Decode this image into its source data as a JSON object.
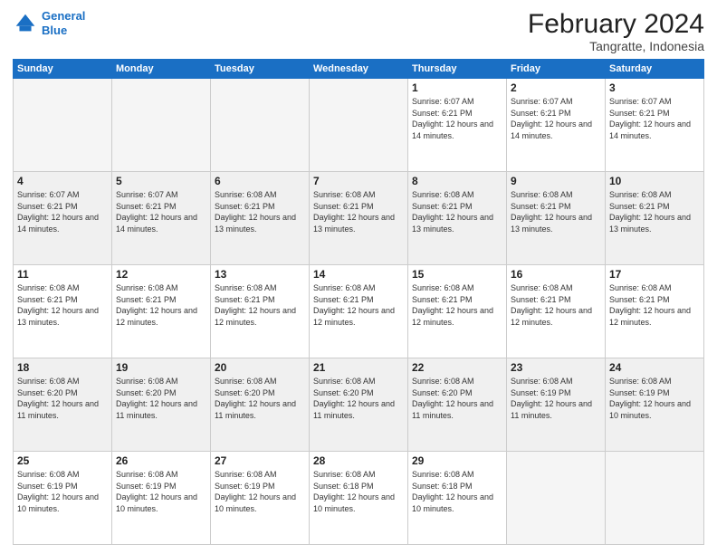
{
  "logo": {
    "line1": "General",
    "line2": "Blue"
  },
  "title": "February 2024",
  "location": "Tangratte, Indonesia",
  "days_header": [
    "Sunday",
    "Monday",
    "Tuesday",
    "Wednesday",
    "Thursday",
    "Friday",
    "Saturday"
  ],
  "weeks": [
    [
      {
        "day": "",
        "sunrise": "",
        "sunset": "",
        "daylight": ""
      },
      {
        "day": "",
        "sunrise": "",
        "sunset": "",
        "daylight": ""
      },
      {
        "day": "",
        "sunrise": "",
        "sunset": "",
        "daylight": ""
      },
      {
        "day": "",
        "sunrise": "",
        "sunset": "",
        "daylight": ""
      },
      {
        "day": "1",
        "sunrise": "Sunrise: 6:07 AM",
        "sunset": "Sunset: 6:21 PM",
        "daylight": "Daylight: 12 hours and 14 minutes."
      },
      {
        "day": "2",
        "sunrise": "Sunrise: 6:07 AM",
        "sunset": "Sunset: 6:21 PM",
        "daylight": "Daylight: 12 hours and 14 minutes."
      },
      {
        "day": "3",
        "sunrise": "Sunrise: 6:07 AM",
        "sunset": "Sunset: 6:21 PM",
        "daylight": "Daylight: 12 hours and 14 minutes."
      }
    ],
    [
      {
        "day": "4",
        "sunrise": "Sunrise: 6:07 AM",
        "sunset": "Sunset: 6:21 PM",
        "daylight": "Daylight: 12 hours and 14 minutes."
      },
      {
        "day": "5",
        "sunrise": "Sunrise: 6:07 AM",
        "sunset": "Sunset: 6:21 PM",
        "daylight": "Daylight: 12 hours and 14 minutes."
      },
      {
        "day": "6",
        "sunrise": "Sunrise: 6:08 AM",
        "sunset": "Sunset: 6:21 PM",
        "daylight": "Daylight: 12 hours and 13 minutes."
      },
      {
        "day": "7",
        "sunrise": "Sunrise: 6:08 AM",
        "sunset": "Sunset: 6:21 PM",
        "daylight": "Daylight: 12 hours and 13 minutes."
      },
      {
        "day": "8",
        "sunrise": "Sunrise: 6:08 AM",
        "sunset": "Sunset: 6:21 PM",
        "daylight": "Daylight: 12 hours and 13 minutes."
      },
      {
        "day": "9",
        "sunrise": "Sunrise: 6:08 AM",
        "sunset": "Sunset: 6:21 PM",
        "daylight": "Daylight: 12 hours and 13 minutes."
      },
      {
        "day": "10",
        "sunrise": "Sunrise: 6:08 AM",
        "sunset": "Sunset: 6:21 PM",
        "daylight": "Daylight: 12 hours and 13 minutes."
      }
    ],
    [
      {
        "day": "11",
        "sunrise": "Sunrise: 6:08 AM",
        "sunset": "Sunset: 6:21 PM",
        "daylight": "Daylight: 12 hours and 13 minutes."
      },
      {
        "day": "12",
        "sunrise": "Sunrise: 6:08 AM",
        "sunset": "Sunset: 6:21 PM",
        "daylight": "Daylight: 12 hours and 12 minutes."
      },
      {
        "day": "13",
        "sunrise": "Sunrise: 6:08 AM",
        "sunset": "Sunset: 6:21 PM",
        "daylight": "Daylight: 12 hours and 12 minutes."
      },
      {
        "day": "14",
        "sunrise": "Sunrise: 6:08 AM",
        "sunset": "Sunset: 6:21 PM",
        "daylight": "Daylight: 12 hours and 12 minutes."
      },
      {
        "day": "15",
        "sunrise": "Sunrise: 6:08 AM",
        "sunset": "Sunset: 6:21 PM",
        "daylight": "Daylight: 12 hours and 12 minutes."
      },
      {
        "day": "16",
        "sunrise": "Sunrise: 6:08 AM",
        "sunset": "Sunset: 6:21 PM",
        "daylight": "Daylight: 12 hours and 12 minutes."
      },
      {
        "day": "17",
        "sunrise": "Sunrise: 6:08 AM",
        "sunset": "Sunset: 6:21 PM",
        "daylight": "Daylight: 12 hours and 12 minutes."
      }
    ],
    [
      {
        "day": "18",
        "sunrise": "Sunrise: 6:08 AM",
        "sunset": "Sunset: 6:20 PM",
        "daylight": "Daylight: 12 hours and 11 minutes."
      },
      {
        "day": "19",
        "sunrise": "Sunrise: 6:08 AM",
        "sunset": "Sunset: 6:20 PM",
        "daylight": "Daylight: 12 hours and 11 minutes."
      },
      {
        "day": "20",
        "sunrise": "Sunrise: 6:08 AM",
        "sunset": "Sunset: 6:20 PM",
        "daylight": "Daylight: 12 hours and 11 minutes."
      },
      {
        "day": "21",
        "sunrise": "Sunrise: 6:08 AM",
        "sunset": "Sunset: 6:20 PM",
        "daylight": "Daylight: 12 hours and 11 minutes."
      },
      {
        "day": "22",
        "sunrise": "Sunrise: 6:08 AM",
        "sunset": "Sunset: 6:20 PM",
        "daylight": "Daylight: 12 hours and 11 minutes."
      },
      {
        "day": "23",
        "sunrise": "Sunrise: 6:08 AM",
        "sunset": "Sunset: 6:19 PM",
        "daylight": "Daylight: 12 hours and 11 minutes."
      },
      {
        "day": "24",
        "sunrise": "Sunrise: 6:08 AM",
        "sunset": "Sunset: 6:19 PM",
        "daylight": "Daylight: 12 hours and 10 minutes."
      }
    ],
    [
      {
        "day": "25",
        "sunrise": "Sunrise: 6:08 AM",
        "sunset": "Sunset: 6:19 PM",
        "daylight": "Daylight: 12 hours and 10 minutes."
      },
      {
        "day": "26",
        "sunrise": "Sunrise: 6:08 AM",
        "sunset": "Sunset: 6:19 PM",
        "daylight": "Daylight: 12 hours and 10 minutes."
      },
      {
        "day": "27",
        "sunrise": "Sunrise: 6:08 AM",
        "sunset": "Sunset: 6:19 PM",
        "daylight": "Daylight: 12 hours and 10 minutes."
      },
      {
        "day": "28",
        "sunrise": "Sunrise: 6:08 AM",
        "sunset": "Sunset: 6:18 PM",
        "daylight": "Daylight: 12 hours and 10 minutes."
      },
      {
        "day": "29",
        "sunrise": "Sunrise: 6:08 AM",
        "sunset": "Sunset: 6:18 PM",
        "daylight": "Daylight: 12 hours and 10 minutes."
      },
      {
        "day": "",
        "sunrise": "",
        "sunset": "",
        "daylight": ""
      },
      {
        "day": "",
        "sunrise": "",
        "sunset": "",
        "daylight": ""
      }
    ]
  ]
}
